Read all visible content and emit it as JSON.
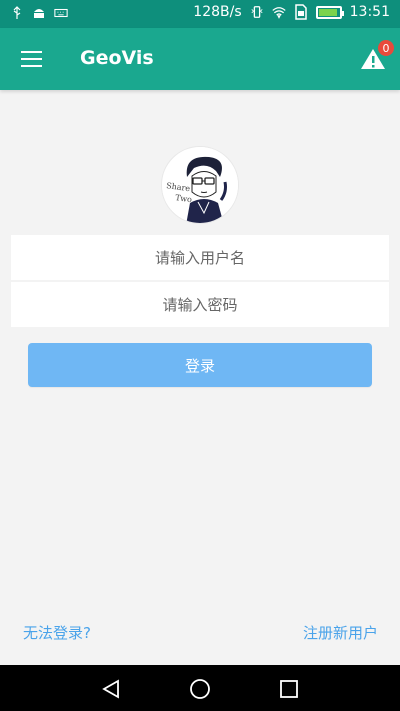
{
  "status_bar": {
    "speed": "128B/s",
    "time": "13:51",
    "icons": [
      "usb-icon",
      "android-icon",
      "keyboard-icon",
      "vibrate-icon",
      "wifi-icon",
      "sim-icon",
      "battery-icon"
    ]
  },
  "app_bar": {
    "title": "GeoVis",
    "alert_count": "0"
  },
  "avatar": {
    "signature_lines": [
      "Share",
      "Two"
    ]
  },
  "form": {
    "username_placeholder": "请输入用户名",
    "password_placeholder": "请输入密码",
    "login_label": "登录"
  },
  "footer": {
    "forgot_label": "无法登录?",
    "register_label": "注册新用户"
  },
  "colors": {
    "status_bar": "#0e8f7c",
    "app_bar": "#1aa88f",
    "login_button": "#6fb7f4",
    "link": "#4aa3ea",
    "badge": "#e84b3c"
  }
}
